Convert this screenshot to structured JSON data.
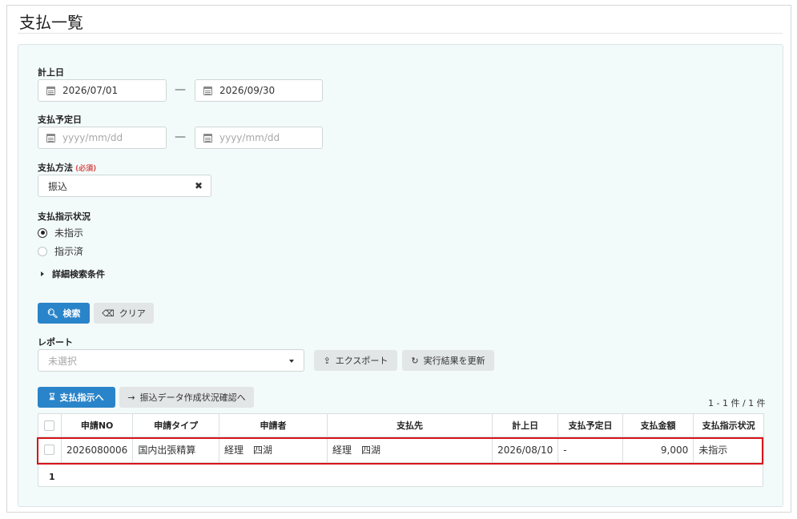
{
  "page": {
    "title": "支払一覧"
  },
  "search": {
    "posting_date": {
      "label": "計上日",
      "from": "2026/07/01",
      "to": "2026/09/30",
      "separator": "—"
    },
    "scheduled_date": {
      "label": "支払予定日",
      "from_placeholder": "yyyy/mm/dd",
      "to_placeholder": "yyyy/mm/dd",
      "separator": "—"
    },
    "payment_method": {
      "label": "支払方法",
      "required": "(必須)",
      "value": "振込"
    },
    "instruction_status": {
      "label": "支払指示状況",
      "options": [
        {
          "label": "未指示",
          "checked": true
        },
        {
          "label": "指示済",
          "checked": false
        }
      ]
    },
    "advanced_toggle": "詳細検索条件",
    "search_button": "検索",
    "clear_button": "クリア"
  },
  "report": {
    "label": "レポート",
    "placeholder": "未選択",
    "export_button": "エクスポート",
    "refresh_button": "実行結果を更新"
  },
  "actions": {
    "instruct_button": "支払指示へ",
    "transfer_status_button": "振込データ作成状況確認へ"
  },
  "results": {
    "count_text": "1 - 1 件 / 1 件",
    "columns": [
      "",
      "申請NO",
      "申請タイプ",
      "申請者",
      "支払先",
      "計上日",
      "支払予定日",
      "支払金額",
      "支払指示状況"
    ],
    "rows": [
      [
        "",
        "2026080006",
        "国内出張精算",
        "経理　四湖",
        "経理　四湖",
        "2026/08/10",
        "-",
        "9,000",
        "未指示"
      ]
    ],
    "page": "1"
  },
  "colors": {
    "primary": "#2a84c9",
    "panel_bg": "#f3fafa",
    "highlight": "#d9141b"
  }
}
